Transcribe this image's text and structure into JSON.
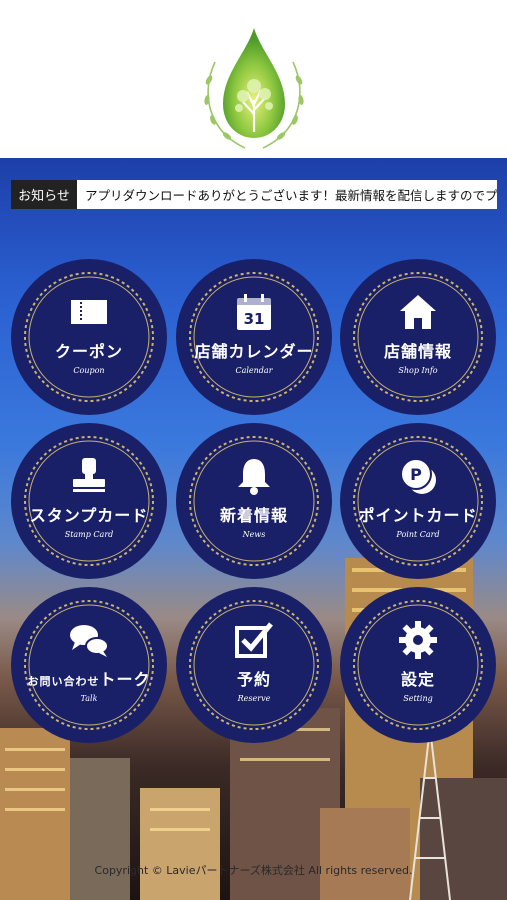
{
  "notice": {
    "label": "お知らせ",
    "text": "アプリダウンロードありがとうございます！最新情報を配信しますのでプッ"
  },
  "menu": [
    {
      "label": "クーポン",
      "sub": "Coupon",
      "icon": "ticket-icon"
    },
    {
      "label": "店舗カレンダー",
      "sub": "Calendar",
      "icon": "calendar-icon",
      "icon_text": "31"
    },
    {
      "label": "店舗情報",
      "sub": "Shop Info",
      "icon": "house-icon"
    },
    {
      "label": "スタンプカード",
      "sub": "Stamp Card",
      "icon": "stamp-icon"
    },
    {
      "label": "新着情報",
      "sub": "News",
      "icon": "bell-icon"
    },
    {
      "label": "ポイントカード",
      "sub": "Point Card",
      "icon": "point-coin-icon",
      "icon_text": "P"
    },
    {
      "label_small": "お問い合わせ",
      "label": "トーク",
      "sub": "Talk",
      "icon": "chat-bubbles-icon"
    },
    {
      "label": "予約",
      "sub": "Reserve",
      "icon": "checkbox-icon"
    },
    {
      "label": "設定",
      "sub": "Setting",
      "icon": "gear-icon"
    }
  ],
  "footer": {
    "copyright": "Copyright © Lavieパートナーズ株式会社 All rights reserved."
  },
  "colors": {
    "tile": "#1a2067",
    "ring": "#c8b370",
    "logo_green": "#8cc63f"
  }
}
